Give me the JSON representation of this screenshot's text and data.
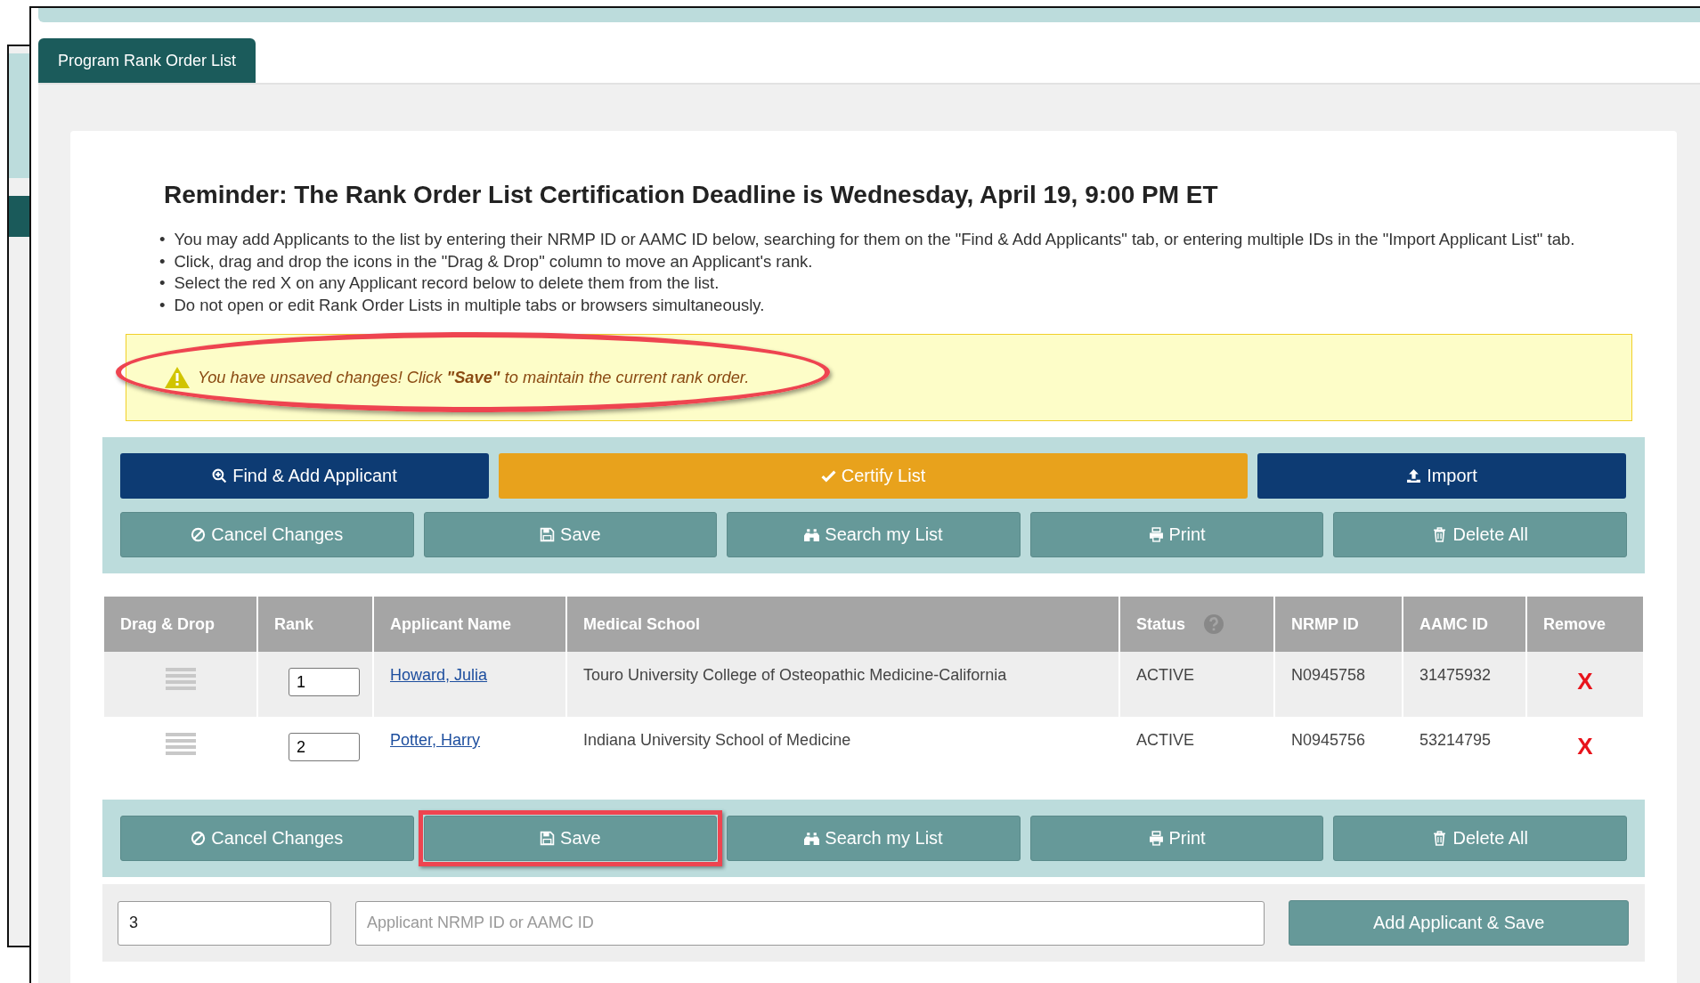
{
  "tabs": [
    {
      "label": "Program Rank Order List",
      "selected": true
    }
  ],
  "reminder": {
    "heading": "Reminder: The Rank Order List Certification Deadline is Wednesday, April 19, 9:00 PM ET",
    "bullets": [
      {
        "marker": "•",
        "text": "You may add Applicants to the list by entering their NRMP ID or AAMC ID below, searching for them on the \"Find & Add Applicants\" tab, or entering multiple IDs in the \"Import Applicant List\" tab."
      },
      {
        "marker": "•",
        "text": "Click, drag and drop the icons in the \"Drag & Drop\" column to move an Applicant's rank."
      },
      {
        "marker": "•",
        "text": "Select the red X on any Applicant record below to delete them from the list."
      },
      {
        "marker": "•",
        "text": "Do not open or edit Rank Order Lists in multiple tabs or browsers simultaneously."
      }
    ]
  },
  "alert": {
    "message": "You have unsaved changes!  Click **\"Save\"** to maintain the current rank order.",
    "circled": true
  },
  "primary_actions": [
    {
      "label": "Find & Add Applicant",
      "kind": "find"
    },
    {
      "label": "Certify List",
      "kind": "certify"
    },
    {
      "label": "Import",
      "kind": "import"
    }
  ],
  "toolbar_top": [
    {
      "label": "Cancel Changes",
      "kind": "cancel",
      "highlighted": false
    },
    {
      "label": "Save",
      "kind": "save",
      "highlighted": false
    },
    {
      "label": "Search my List",
      "kind": "search",
      "highlighted": false
    },
    {
      "label": "Print",
      "kind": "print",
      "highlighted": false
    },
    {
      "label": "Delete All",
      "kind": "delete",
      "highlighted": false
    }
  ],
  "table": {
    "columns": [
      {
        "label": "Drag & Drop",
        "help": false
      },
      {
        "label": "Rank",
        "help": false
      },
      {
        "label": "Applicant Name",
        "help": false
      },
      {
        "label": "Medical School",
        "help": false
      },
      {
        "label": "Status",
        "help": true
      },
      {
        "label": "NRMP ID",
        "help": false
      },
      {
        "label": "AAMC ID",
        "help": false
      },
      {
        "label": "Remove",
        "help": false
      }
    ],
    "rows": [
      {
        "rank": "1",
        "name": "Howard, Julia",
        "school": "Touro University College of Osteopathic Medicine-California",
        "status": "ACTIVE",
        "nrmp_id": "N0945758",
        "aamc_id": "31475932",
        "remove": "X"
      },
      {
        "rank": "2",
        "name": "Potter, Harry",
        "school": "Indiana University School of Medicine",
        "status": "ACTIVE",
        "nrmp_id": "N0945756",
        "aamc_id": "53214795",
        "remove": "X"
      }
    ]
  },
  "toolbar_bottom": [
    {
      "label": "Cancel Changes",
      "kind": "cancel",
      "highlighted": false
    },
    {
      "label": "Save",
      "kind": "save",
      "highlighted": true
    },
    {
      "label": "Search my List",
      "kind": "search",
      "highlighted": false
    },
    {
      "label": "Print",
      "kind": "print",
      "highlighted": false
    },
    {
      "label": "Delete All",
      "kind": "delete",
      "highlighted": false
    }
  ],
  "add_form": {
    "rank": "3",
    "id_placeholder": "Applicant NRMP ID or AAMC ID",
    "button": "Add Applicant & Save"
  }
}
